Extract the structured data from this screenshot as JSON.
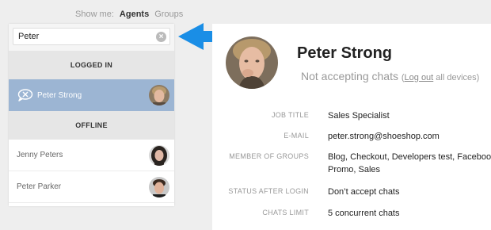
{
  "show_me": {
    "label": "Show me:",
    "agents": "Agents",
    "groups": "Groups"
  },
  "search": {
    "value": "Peter",
    "placeholder": "",
    "clear_icon": "×"
  },
  "sections": {
    "logged_in": "LOGGED IN",
    "offline": "OFFLINE"
  },
  "logged_in_agents": [
    {
      "name": "Peter Strong",
      "status_icon": "not-accepting-chats-icon",
      "selected": true
    }
  ],
  "offline_agents": [
    {
      "name": "Jenny Peters"
    },
    {
      "name": "Peter Parker"
    }
  ],
  "profile": {
    "name": "Peter Strong",
    "status": "Not accepting chats",
    "status_note_open": "(",
    "logout_link": "Log out",
    "status_note_close": " all devices)",
    "details": [
      {
        "label": "JOB TITLE",
        "value": "Sales Specialist"
      },
      {
        "label": "E-MAIL",
        "value": "peter.strong@shoeshop.com"
      },
      {
        "label": "MEMBER OF GROUPS",
        "value": "Blog, Checkout, Developers test, Facebook, Promo, Sales"
      },
      {
        "label": "STATUS AFTER LOGIN",
        "value": "Don’t accept chats"
      },
      {
        "label": "CHATS LIMIT",
        "value": "5 concurrent chats"
      }
    ]
  },
  "colors": {
    "selected_row": "#9cb5d3",
    "arrow": "#1a8ee6",
    "section_header_bg": "#e6e6e6"
  }
}
